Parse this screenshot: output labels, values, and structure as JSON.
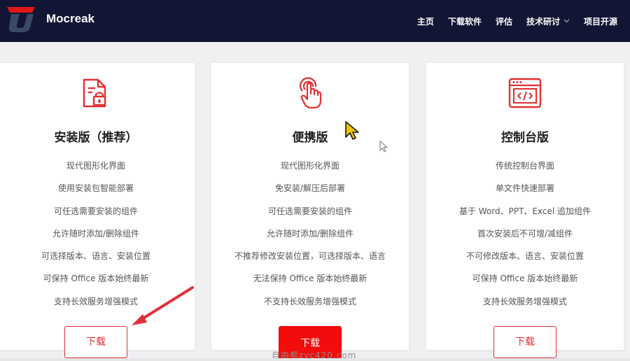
{
  "header": {
    "brand": "Mocreak",
    "nav": [
      "主页",
      "下载软件",
      "评估",
      "技术研讨",
      "项目开源"
    ]
  },
  "cards": [
    {
      "icon": "installer-document-icon",
      "title": "安装版（推荐）",
      "features": [
        "现代图形化界面",
        "使用安装包智能部署",
        "可任选需要安装的组件",
        "允许随时添加/删除组件",
        "可选择版本、语言、安装位置",
        "可保持 Office 版本始终最新",
        "支持长效服务增强模式"
      ],
      "button": "下载",
      "button_style": "outline"
    },
    {
      "icon": "touch-hand-icon",
      "title": "便携版",
      "features": [
        "现代图形化界面",
        "免安装/解压后部署",
        "可任选需要安装的组件",
        "允许随时添加/删除组件",
        "不推荐修改安装位置，可选择版本、语言",
        "无法保持 Office 版本始终最新",
        "不支持长效服务增强模式"
      ],
      "button": "下载",
      "button_style": "filled"
    },
    {
      "icon": "code-window-icon",
      "title": "控制台版",
      "features": [
        "传统控制台界面",
        "单文件快速部署",
        "基于 Word、PPT、Excel 追加组件",
        "首次安装后不可增/减组件",
        "不可修改版本、语言、安装位置",
        "可保持 Office 版本始终最新",
        "支持长效服务增强模式"
      ],
      "button": "下载",
      "button_style": "outline"
    }
  ],
  "watermark": "自由都zyc420.com",
  "colors": {
    "header_bg": "#121634",
    "accent_red": "#e03030",
    "button_fill": "#f20c0c",
    "page_bg": "#f0f0f2"
  }
}
